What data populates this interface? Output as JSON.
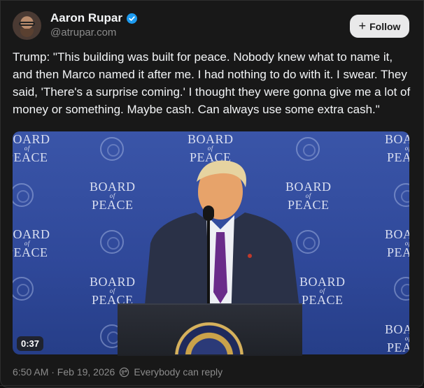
{
  "author": {
    "name": "Aaron Rupar",
    "handle": "@atrupar.com",
    "verified": true
  },
  "actions": {
    "follow_label": "Follow",
    "follow_icon": "plus-icon"
  },
  "post": {
    "text": "Trump: \"This building was built for peace. Nobody knew what to name it, and then Marco named it after me. I had nothing to do with it. I swear. They said, 'There's a surprise coming.' I thought they were gonna give me a lot of money or something. Maybe cash. Can always use some extra cash.\""
  },
  "media": {
    "type": "video",
    "duration": "0:37",
    "backdrop_text": {
      "line1": "BOARD",
      "line2": "of",
      "line3": "PEACE"
    }
  },
  "meta": {
    "timestamp": "6:50 AM · Feb 19, 2026",
    "reply_setting": "Everybody can reply",
    "reply_icon": "everyone-reply-icon"
  },
  "colors": {
    "background": "#181818",
    "text": "#f3f5f7",
    "secondary_text": "#8b8b8b",
    "verified_badge": "#1d9bf0",
    "follow_button_bg": "#e9e9ea",
    "backdrop_blue": "#3a55a8"
  }
}
